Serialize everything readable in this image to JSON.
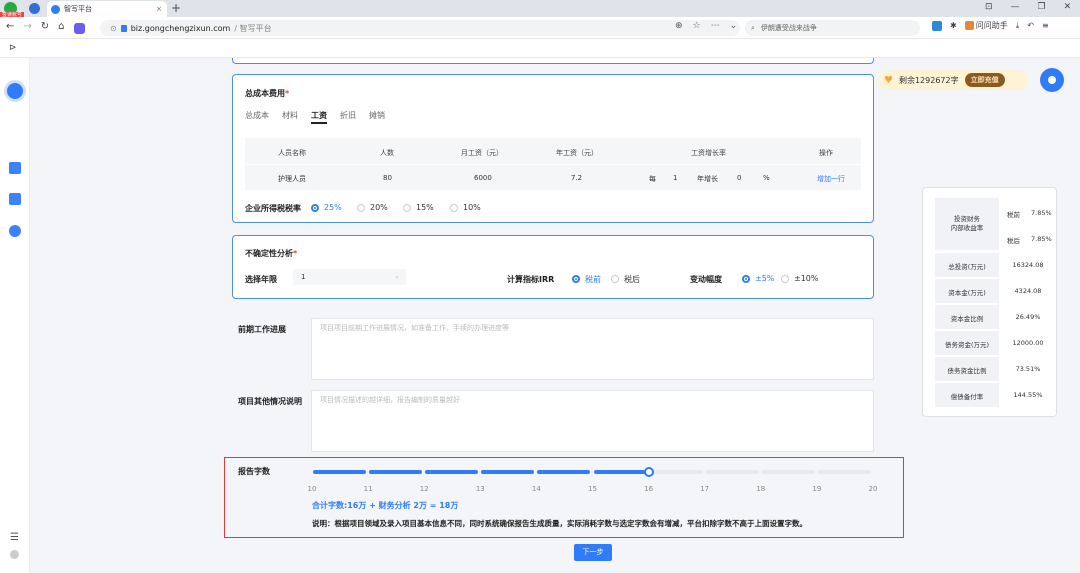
{
  "browser": {
    "badge": "签读帐号",
    "tab_title": "智写平台",
    "new_tab": "+",
    "url_domain": "biz.gongchengzixun.com",
    "url_rest": " / 智写平台",
    "search_text": "伊朗遭受战来战争",
    "ext_label": "问问助手"
  },
  "promo": {
    "remaining": "剩余1292672字",
    "recharge": "立即充值"
  },
  "total_cost": {
    "title": "总成本费用",
    "tabs": [
      "总成本",
      "材料",
      "工资",
      "折旧",
      "摊销"
    ],
    "active_tab": "工资",
    "headers": [
      "人员名称",
      "人数",
      "月工资（元）",
      "年工资（元）",
      "工资增长率",
      "操作"
    ],
    "row": {
      "name": "护理人员",
      "count": "80",
      "monthly": "6000",
      "annual": "7.2",
      "every": "每",
      "years": "1",
      "year_growth": "年增长",
      "rate": "0",
      "percent": "%",
      "add_row": "增加一行"
    },
    "tax_label": "企业所得税税率",
    "tax_options": [
      "25%",
      "20%",
      "15%",
      "10%"
    ],
    "tax_selected": "25%"
  },
  "uncertainty": {
    "title": "不确定性分析",
    "years_label": "选择年限",
    "years_value": "1",
    "irr_label": "计算指标IRR",
    "irr_options": [
      "税前",
      "税后"
    ],
    "range_label": "变动幅度",
    "range_options": [
      "±5%",
      "±10%"
    ]
  },
  "prework": {
    "label": "前期工作进展",
    "placeholder": "项目项目前期工作进展情况，如准备工作，手续的办理进度等"
  },
  "other": {
    "label": "项目其他情况说明",
    "placeholder": "项目情况描述的越详细，报告编制的质量越好"
  },
  "report": {
    "label": "报告字数",
    "ticks": [
      "10",
      "11",
      "12",
      "13",
      "14",
      "15",
      "16",
      "17",
      "18",
      "19",
      "20"
    ],
    "value": 16,
    "min": 10,
    "max": 20,
    "total": "合计字数:16万 + 财务分析 2万 = 18万",
    "note": "说明：根据项目领域及录入项目基本信息不同，同时系统确保报告生成质量，实际消耗字数与选定字数会有增减，平台扣除字数不高于上面设置字数。"
  },
  "next_button": "下一步",
  "stats": {
    "irr_label": "投资财务\n内部收益率",
    "irr_pre_label": "税前",
    "irr_pre": "7.85%",
    "irr_post_label": "税后",
    "irr_post": "7.85%",
    "rows": [
      {
        "label": "总投资(万元)",
        "value": "16324.08"
      },
      {
        "label": "资本金(万元)",
        "value": "4324.08"
      },
      {
        "label": "资本金比例",
        "value": "26.49%"
      },
      {
        "label": "债务资金(万元)",
        "value": "12000.00"
      },
      {
        "label": "债务资金比例",
        "value": "73.51%"
      },
      {
        "label": "偿债备付率",
        "value": "144.55%"
      }
    ]
  },
  "colors": {
    "accent": "#2f7cf6",
    "highlight_border": "#e03a3a",
    "promo_bg": "#fff3d6",
    "recharge_bg": "#8a5a23"
  }
}
